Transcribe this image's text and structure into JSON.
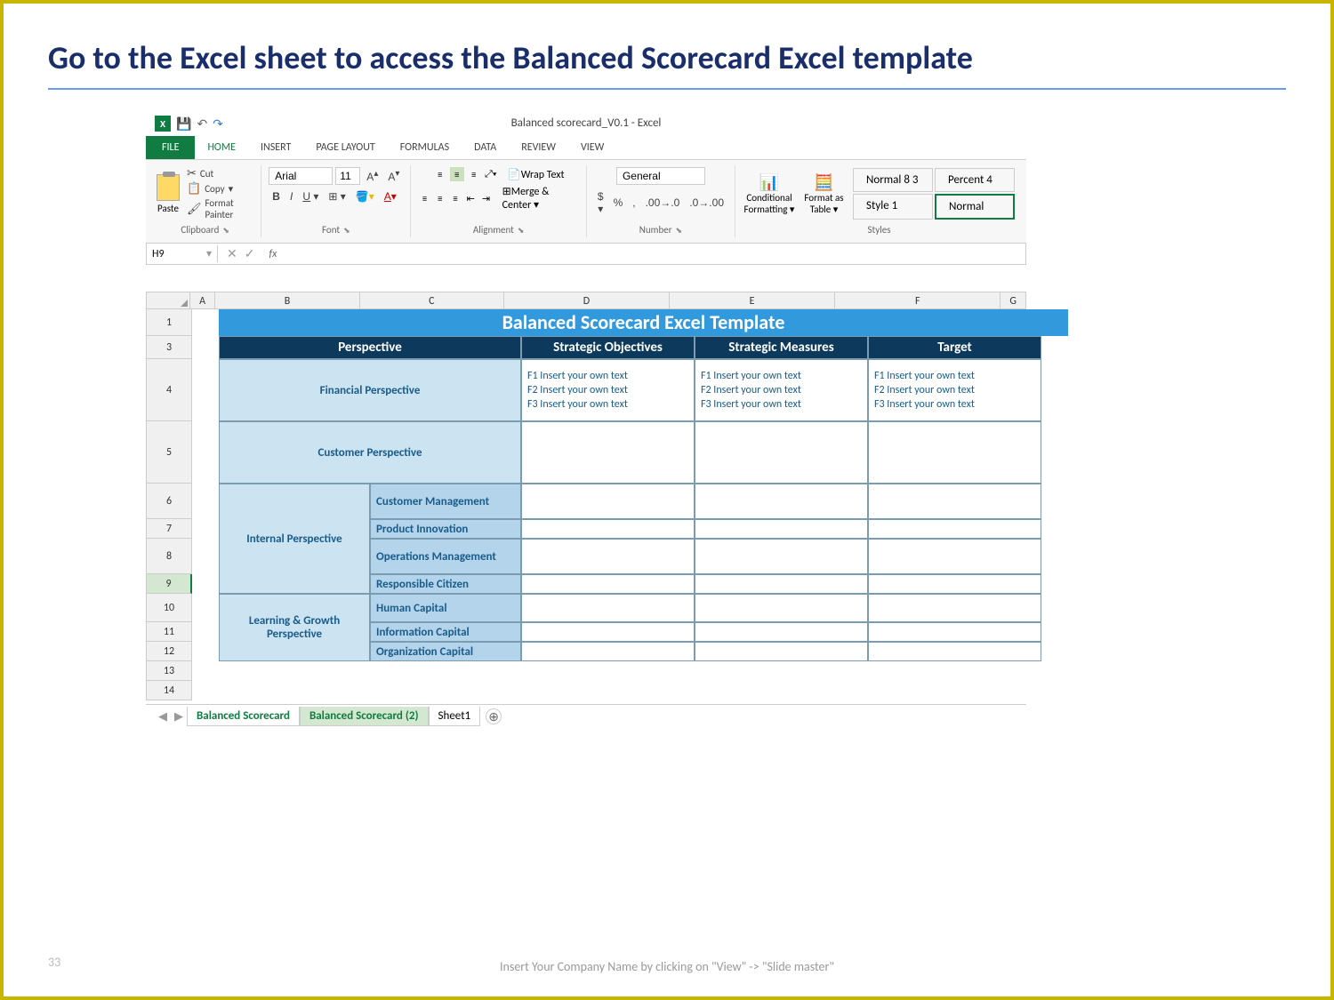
{
  "slide": {
    "title": "Go to the Excel sheet to access the Balanced Scorecard Excel template",
    "page_number": "33",
    "footer": "Insert Your Company Name by clicking on \"View\" -> \"Slide master\""
  },
  "excel": {
    "window_title": "Balanced scorecard_V0.1 - Excel",
    "tabs": {
      "file": "FILE",
      "home": "HOME",
      "insert": "INSERT",
      "page_layout": "PAGE LAYOUT",
      "formulas": "FORMULAS",
      "data": "DATA",
      "review": "REVIEW",
      "view": "VIEW"
    },
    "ribbon": {
      "clipboard": {
        "paste": "Paste",
        "cut": "Cut",
        "copy": "Copy",
        "format_painter": "Format Painter",
        "label": "Clipboard"
      },
      "font": {
        "name": "Arial",
        "size": "11",
        "label": "Font"
      },
      "alignment": {
        "wrap": "Wrap Text",
        "merge": "Merge & Center",
        "label": "Alignment"
      },
      "number": {
        "format": "General",
        "label": "Number"
      },
      "styles": {
        "conditional": "Conditional Formatting",
        "format_table": "Format as Table",
        "normal83": "Normal 8 3",
        "percent4": "Percent 4",
        "style1": "Style 1",
        "normal": "Normal",
        "label": "Styles"
      }
    },
    "formula_bar": {
      "name_box": "H9",
      "fx": "fx"
    },
    "columns": [
      "A",
      "B",
      "C",
      "D",
      "E",
      "F",
      "G"
    ],
    "rows": [
      "1",
      "3",
      "4",
      "5",
      "6",
      "7",
      "8",
      "9",
      "10",
      "11",
      "12",
      "13",
      "14"
    ],
    "sheet_title": "Balanced Scorecard Excel Template",
    "headers": {
      "perspective": "Perspective",
      "objectives": "Strategic Objectives",
      "measures": "Strategic Measures",
      "target": "Target"
    },
    "perspectives": {
      "financial": "Financial Perspective",
      "customer": "Customer Perspective",
      "internal": "Internal Perspective",
      "learning": "Learning & Growth Perspective"
    },
    "internal_subs": {
      "cust_mgmt": "Customer Management",
      "prod_innov": "Product Innovation",
      "ops_mgmt": "Operations Management",
      "resp_citizen": "Responsible Citizen"
    },
    "learning_subs": {
      "human": "Human Capital",
      "info": "Information Capital",
      "org": "Organization Capital"
    },
    "placeholder": {
      "f1": "F1 Insert your own text",
      "f2": "F2 Insert your own text",
      "f3": "F3 Insert your own text"
    },
    "sheet_tabs": {
      "bs": "Balanced Scorecard",
      "bs2": "Balanced Scorecard (2)",
      "sheet1": "Sheet1"
    }
  }
}
